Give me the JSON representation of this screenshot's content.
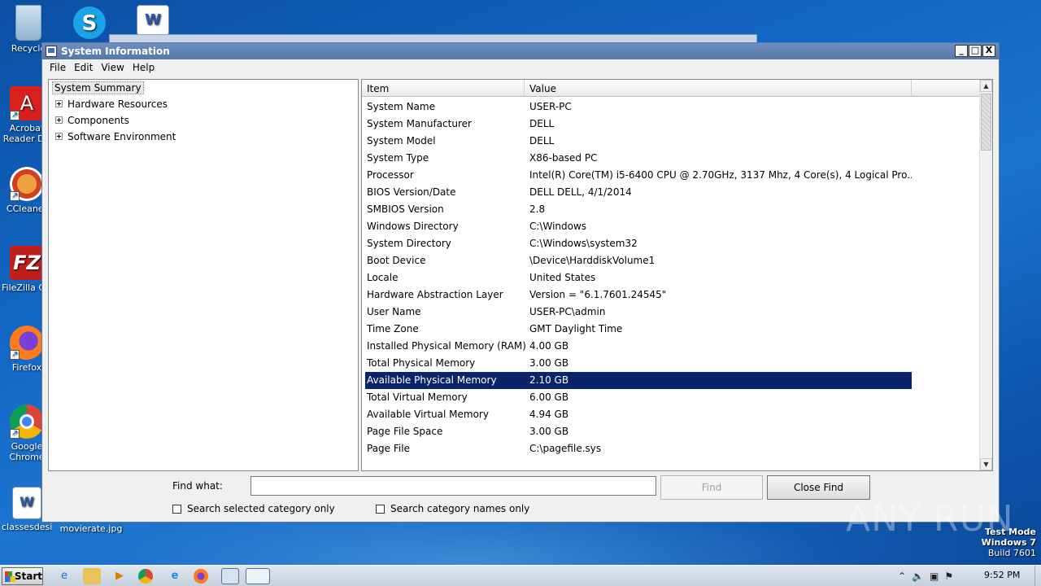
{
  "desktop": {
    "icons": [
      {
        "label": "Recycle",
        "icon": "recycle-bin-icon"
      },
      {
        "label": "Acrobat Reader DC",
        "icon": "acrobat-icon"
      },
      {
        "label": "CCleaner",
        "icon": "ccleaner-icon"
      },
      {
        "label": "FileZilla Client",
        "icon": "filezilla-icon"
      },
      {
        "label": "Firefox",
        "icon": "firefox-icon"
      },
      {
        "label": "Google Chrome",
        "icon": "chrome-icon"
      },
      {
        "label": "classesdesig...",
        "icon": "word-doc-icon"
      },
      {
        "label": "movierate.jpg",
        "icon": "image-file-icon"
      }
    ],
    "watermark": "ANY RUN",
    "test_mode": {
      "line1": "Test Mode",
      "line2": "Windows 7",
      "line3": "Build 7601"
    }
  },
  "window": {
    "title": "System Information",
    "controls": {
      "minimize": "_",
      "maximize": "□",
      "close": "X"
    },
    "menu": [
      "File",
      "Edit",
      "View",
      "Help"
    ],
    "tree": {
      "root": "System Summary",
      "children": [
        "Hardware Resources",
        "Components",
        "Software Environment"
      ]
    },
    "list": {
      "columns": [
        "Item",
        "Value"
      ],
      "rows": [
        {
          "item": "System Name",
          "value": "USER-PC"
        },
        {
          "item": "System Manufacturer",
          "value": "DELL"
        },
        {
          "item": "System Model",
          "value": "DELL"
        },
        {
          "item": "System Type",
          "value": "X86-based PC"
        },
        {
          "item": "Processor",
          "value": "Intel(R) Core(TM) i5-6400 CPU @ 2.70GHz, 3137 Mhz, 4 Core(s), 4 Logical Pro..."
        },
        {
          "item": "BIOS Version/Date",
          "value": "DELL DELL, 4/1/2014"
        },
        {
          "item": "SMBIOS Version",
          "value": "2.8"
        },
        {
          "item": "Windows Directory",
          "value": "C:\\Windows"
        },
        {
          "item": "System Directory",
          "value": "C:\\Windows\\system32"
        },
        {
          "item": "Boot Device",
          "value": "\\Device\\HarddiskVolume1"
        },
        {
          "item": "Locale",
          "value": "United States"
        },
        {
          "item": "Hardware Abstraction Layer",
          "value": "Version = \"6.1.7601.24545\""
        },
        {
          "item": "User Name",
          "value": "USER-PC\\admin"
        },
        {
          "item": "Time Zone",
          "value": "GMT Daylight Time"
        },
        {
          "item": "Installed Physical Memory (RAM)",
          "value": "4.00 GB"
        },
        {
          "item": "Total Physical Memory",
          "value": "3.00 GB"
        },
        {
          "item": "Available Physical Memory",
          "value": "2.10 GB"
        },
        {
          "item": "Total Virtual Memory",
          "value": "6.00 GB"
        },
        {
          "item": "Available Virtual Memory",
          "value": "4.94 GB"
        },
        {
          "item": "Page File Space",
          "value": "3.00 GB"
        },
        {
          "item": "Page File",
          "value": "C:\\pagefile.sys"
        }
      ],
      "selected_item": "Available Physical Memory"
    },
    "find": {
      "label": "Find what:",
      "value": "",
      "find_button": "Find",
      "close_find_button": "Close Find",
      "option_selected_category": "Search selected category only",
      "option_category_names": "Search category names only"
    }
  },
  "taskbar": {
    "start_label": "Start",
    "pinned": [
      "internet-explorer-icon",
      "explorer-icon",
      "media-player-icon",
      "chrome-icon",
      "edge-icon",
      "firefox-icon",
      "task-manager-icon",
      "system-info-icon"
    ],
    "time": "9:52 PM"
  }
}
